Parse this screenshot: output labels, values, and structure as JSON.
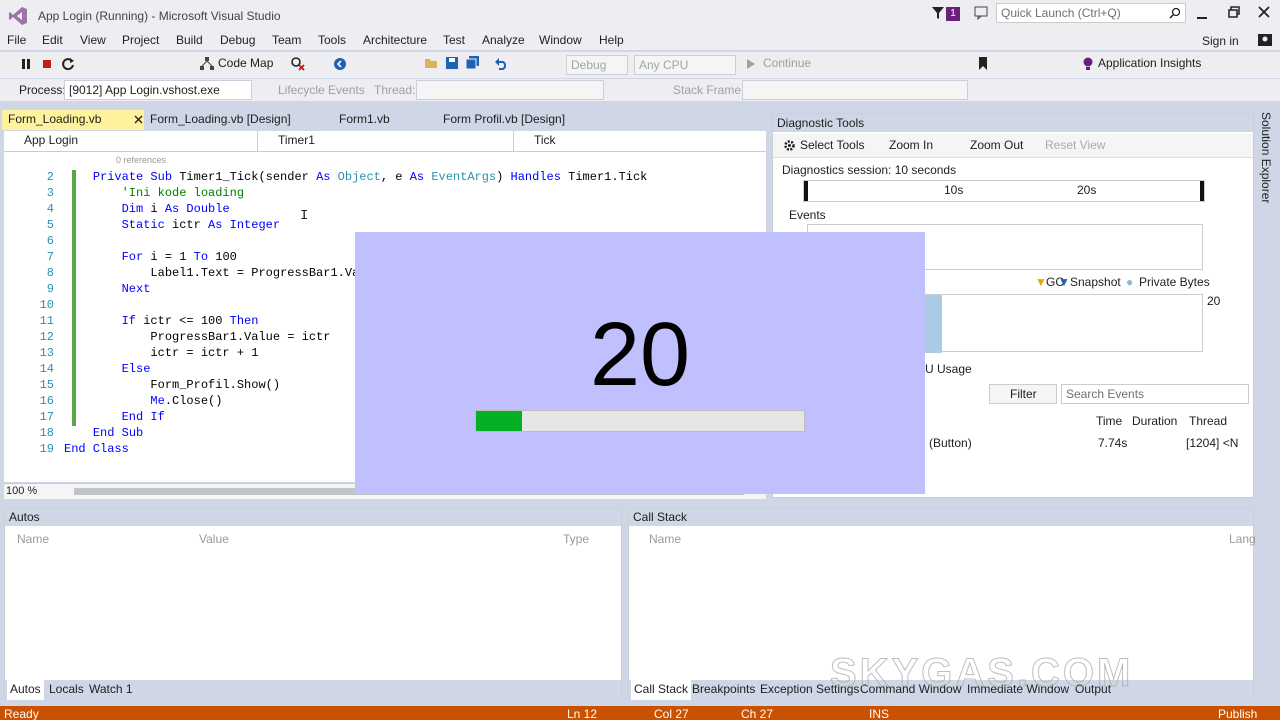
{
  "window": {
    "title": "App Login (Running) - Microsoft Visual Studio",
    "quick_launch_placeholder": "Quick Launch (Ctrl+Q)",
    "notification_count": "1",
    "sign_in": "Sign in"
  },
  "menu": [
    "File",
    "Edit",
    "View",
    "Project",
    "Build",
    "Debug",
    "Team",
    "Tools",
    "Architecture",
    "Test",
    "Analyze",
    "Window",
    "Help"
  ],
  "toolbar": {
    "code_map": "Code Map",
    "config": "Debug",
    "platform": "Any CPU",
    "continue": "Continue",
    "app_insights": "Application Insights"
  },
  "debug_bar": {
    "process_label": "Process:",
    "process_value": "[9012] App Login.vshost.exe",
    "lifecycle": "Lifecycle Events",
    "thread_label": "Thread:",
    "stack_frame_label": "Stack Frame:"
  },
  "tabs": [
    "Form_Loading.vb",
    "Form_Loading.vb [Design]",
    "Form1.vb",
    "Form Profil.vb [Design]"
  ],
  "nav": {
    "project": "App Login",
    "object": "Timer1",
    "event": "Tick"
  },
  "code": {
    "refs": "0 references",
    "lines": [
      {
        "n": "2",
        "parts": [
          [
            "kw",
            "Private Sub "
          ],
          [
            "tx",
            "Timer1_Tick(sender "
          ],
          [
            "kw",
            "As "
          ],
          [
            "ty",
            "Object"
          ],
          [
            "tx",
            ", e "
          ],
          [
            "kw",
            "As "
          ],
          [
            "ty",
            "EventArgs"
          ],
          [
            "tx",
            ") "
          ],
          [
            "kw",
            "Handles "
          ],
          [
            "tx",
            "Timer1.Tick"
          ]
        ],
        "indent": "    "
      },
      {
        "n": "3",
        "parts": [
          [
            "cm",
            "'Ini kode loading"
          ]
        ],
        "indent": "        "
      },
      {
        "n": "4",
        "parts": [
          [
            "kw",
            "Dim "
          ],
          [
            "tx",
            "i "
          ],
          [
            "kw",
            "As Double"
          ]
        ],
        "indent": "        "
      },
      {
        "n": "5",
        "parts": [
          [
            "kw",
            "Static "
          ],
          [
            "tx",
            "ictr "
          ],
          [
            "kw",
            "As Integer"
          ]
        ],
        "indent": "        "
      },
      {
        "n": "6",
        "parts": [],
        "indent": ""
      },
      {
        "n": "7",
        "parts": [
          [
            "kw",
            "For "
          ],
          [
            "tx",
            "i = 1 "
          ],
          [
            "kw",
            "To "
          ],
          [
            "tx",
            "100"
          ]
        ],
        "indent": "        "
      },
      {
        "n": "8",
        "parts": [
          [
            "tx",
            "Label1.Text = ProgressBar1.Va"
          ]
        ],
        "indent": "            "
      },
      {
        "n": "9",
        "parts": [
          [
            "kw",
            "Next"
          ]
        ],
        "indent": "        "
      },
      {
        "n": "10",
        "parts": [],
        "indent": ""
      },
      {
        "n": "11",
        "parts": [
          [
            "kw",
            "If "
          ],
          [
            "tx",
            "ictr <= 100 "
          ],
          [
            "kw",
            "Then"
          ]
        ],
        "indent": "        "
      },
      {
        "n": "12",
        "parts": [
          [
            "tx",
            "ProgressBar1.Value = ictr"
          ]
        ],
        "indent": "            "
      },
      {
        "n": "13",
        "parts": [
          [
            "tx",
            "ictr = ictr + 1"
          ]
        ],
        "indent": "            "
      },
      {
        "n": "14",
        "parts": [
          [
            "kw",
            "Else"
          ]
        ],
        "indent": "        "
      },
      {
        "n": "15",
        "parts": [
          [
            "tx",
            "Form_Profil.Show()"
          ]
        ],
        "indent": "            "
      },
      {
        "n": "16",
        "parts": [
          [
            "kw",
            "Me"
          ],
          [
            "tx",
            ".Close()"
          ]
        ],
        "indent": "            "
      },
      {
        "n": "17",
        "parts": [
          [
            "kw",
            "End If"
          ]
        ],
        "indent": "        "
      },
      {
        "n": "18",
        "parts": [
          [
            "kw",
            "End Sub"
          ]
        ],
        "indent": "    "
      },
      {
        "n": "19",
        "parts": [
          [
            "kw",
            "End Class"
          ]
        ],
        "indent": ""
      }
    ],
    "zoom": "100 %"
  },
  "diagnostic": {
    "title": "Diagnostic Tools",
    "select_tools": "Select Tools",
    "zoom_in": "Zoom In",
    "zoom_out": "Zoom Out",
    "reset_view": "Reset View",
    "session": "Diagnostics session: 10 seconds",
    "tick_10": "10s",
    "tick_20": "20s",
    "events": "Events",
    "legend": [
      "GC",
      "Snapshot",
      "Private Bytes"
    ],
    "mem_val": "20",
    "cpu_usage": "U Usage",
    "filter": "Filter",
    "search_placeholder": "Search Events",
    "cols": [
      "Time",
      "Duration",
      "Thread"
    ],
    "row": {
      "name": "(Button)",
      "time": "7.74s",
      "thread": "[1204] <N"
    }
  },
  "autos": {
    "title": "Autos",
    "cols": [
      "Name",
      "Value",
      "Type"
    ],
    "tabs": [
      "Autos",
      "Locals",
      "Watch 1"
    ]
  },
  "callstack": {
    "title": "Call Stack",
    "cols": [
      "Name",
      "Lang"
    ],
    "tabs": [
      "Call Stack",
      "Breakpoints",
      "Exception Settings",
      "Command Window",
      "Immediate Window",
      "Output"
    ]
  },
  "status": {
    "ready": "Ready",
    "ln": "Ln 12",
    "col": "Col 27",
    "ch": "Ch 27",
    "ins": "INS",
    "publish": "Publish"
  },
  "form": {
    "label": "20",
    "progress": 0.14
  },
  "watermark": "SKYGAS.COM",
  "colors": {
    "status": "#ca5100",
    "progress": "#06b025",
    "form_bg": "#c0c0ff",
    "active_tab": "#fff29d"
  }
}
